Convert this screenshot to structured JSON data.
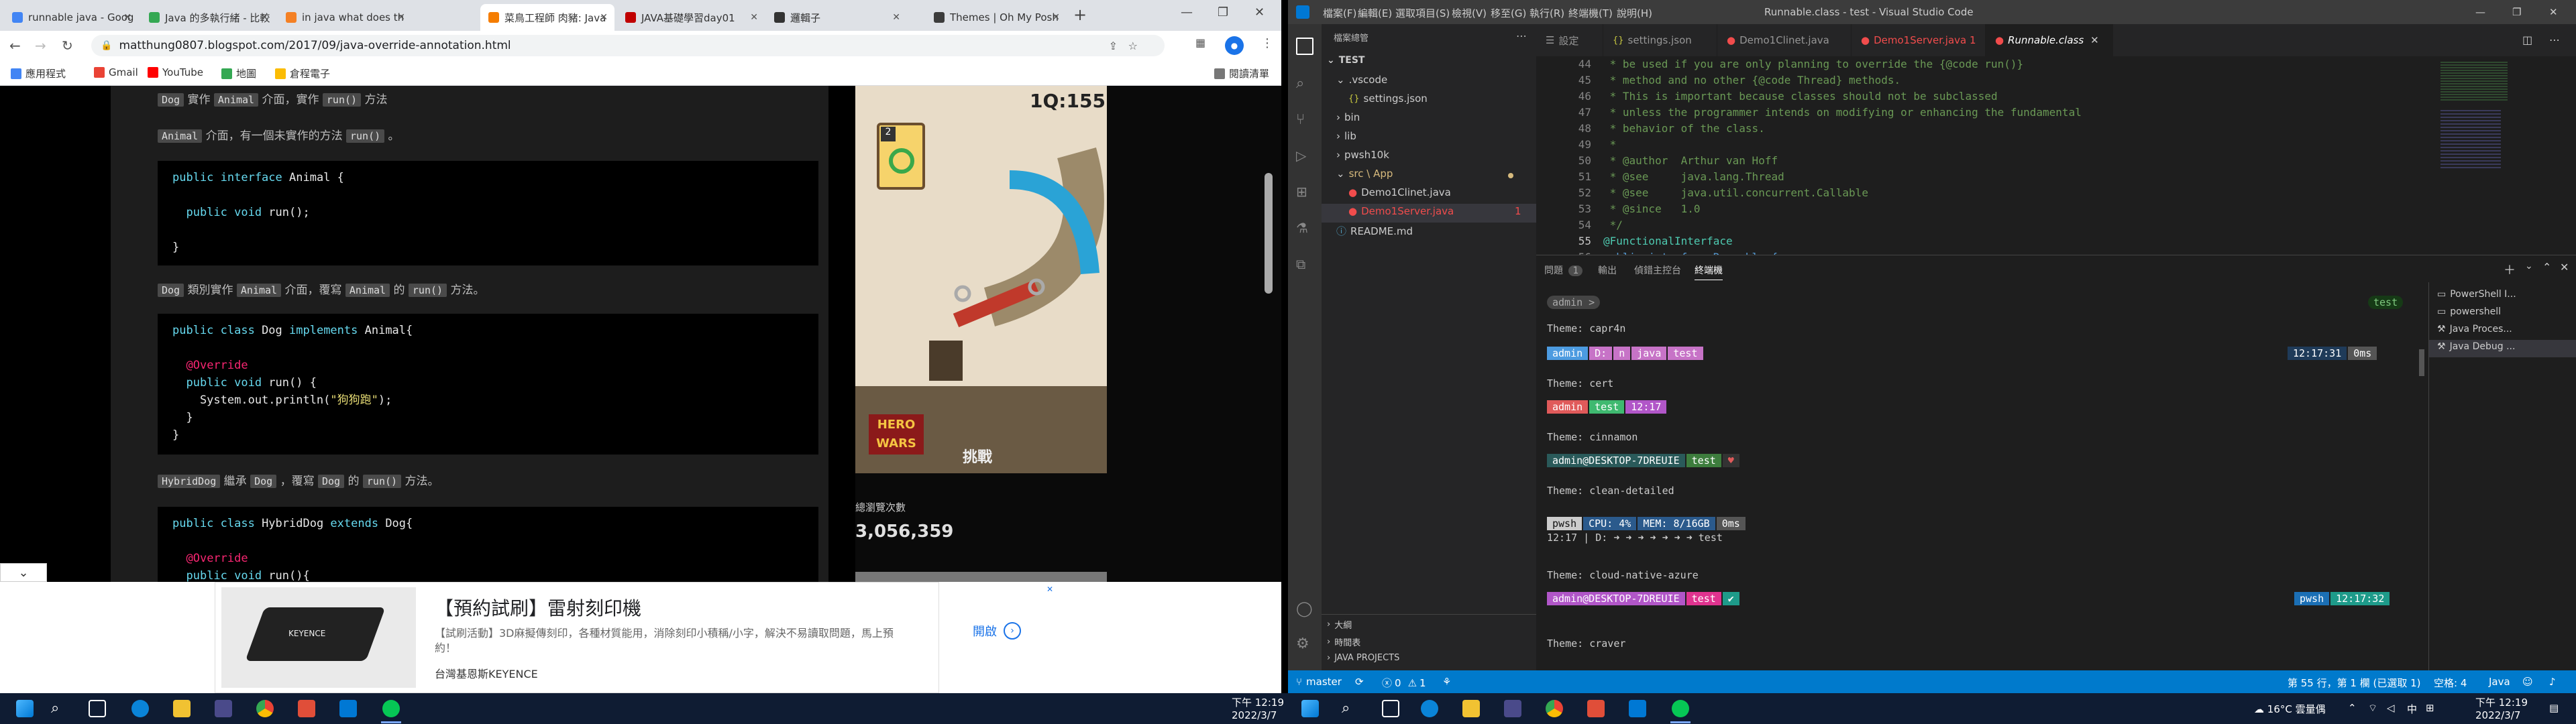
{
  "browser": {
    "tabs": [
      {
        "label": "runnable java - Goog",
        "color": "#4285f4"
      },
      {
        "label": "Java 的多執行緒 - 比較",
        "color": "#34a853"
      },
      {
        "label": "in java what does th",
        "color": "#f48024"
      },
      {
        "label": "菜鳥工程師 肉豬: Java",
        "color": "#f57d00"
      },
      {
        "label": "JAVA基礎學習day01",
        "color": "#c00000"
      },
      {
        "label": "邏輯子",
        "color": "#333333"
      },
      {
        "label": "Themes | Oh My Posh",
        "color": "#3c3c3c"
      }
    ],
    "new_tab": "+",
    "url": "matthung0807.blogspot.com/2017/09/java-override-annotation.html",
    "bookmarks": [
      "應用程式",
      "Gmail",
      "YouTube",
      "地圖",
      "倉程電子",
      "閱讀清單"
    ],
    "blog": {
      "line1": {
        "a": "Dog",
        "b": " 實作 ",
        "c": "Animal",
        "d": " 介面，實作 ",
        "e": "run()",
        "f": " 方法"
      },
      "line2": {
        "a": "Animal",
        "b": " 介面，有一個未實作的方法 ",
        "c": "run()",
        "d": " 。"
      },
      "code1": [
        "public interface Animal {",
        "",
        "  public void run();",
        "",
        "}"
      ],
      "line3": {
        "a": "Dog",
        "b": " 類別實作 ",
        "c": "Animal",
        "d": " 介面，覆寫 ",
        "e": "Animal",
        "f": " 的 ",
        "g": "run()",
        "h": " 方法。"
      },
      "code2": [
        "public class Dog implements Animal{",
        "",
        "  @Override",
        "  public void run() {",
        "    System.out.println(\"狗狗跑\");",
        "  }",
        "}"
      ],
      "line4": {
        "a": "HybridDog",
        "b": " 繼承 ",
        "c": "Dog",
        "d": " ，覆寫 ",
        "e": "Dog",
        "f": " 的 ",
        "g": "run()",
        "h": " 方法。"
      },
      "code3": [
        "public class HybridDog extends Dog{",
        "",
        "  @Override",
        "  public void run(){"
      ]
    },
    "sidebar": {
      "game_timer": "1Q:155",
      "game_badge": "2",
      "game_logo": "HERO WARS",
      "game_button": "挑戰",
      "stats_label": "總瀏覽次數",
      "stats_value": "3,056,359"
    },
    "ad": {
      "title": "【預約試刷】雷射刻印機",
      "desc": "【試刷活動】3D麻擬傳刻印，各種材質能用，消除刻印小積稱/小字，解決不易讀取問題，馬上預約！",
      "brand": "台灣基恩斯KEYENCE",
      "cta": "開啟",
      "product": "KEYENCE"
    }
  },
  "vscode": {
    "title": "Runnable.class - test - Visual Studio Code",
    "menu": [
      "檔案(F)",
      "編輯(E)",
      "選取項目(S)",
      "檢視(V)",
      "移至(G)",
      "執行(R)",
      "終端機(T)",
      "說明(H)"
    ],
    "explorer": {
      "header": "檔案總管",
      "root": "TEST",
      "items": [
        {
          "label": ".vscode",
          "type": "folder-open"
        },
        {
          "label": "settings.json",
          "type": "json"
        },
        {
          "label": "bin",
          "type": "folder"
        },
        {
          "label": "lib",
          "type": "folder"
        },
        {
          "label": "pwsh10k",
          "type": "folder"
        },
        {
          "label": "src \\ App",
          "type": "folder-open"
        },
        {
          "label": "Demo1Clinet.java",
          "type": "java-error"
        },
        {
          "label": "Demo1Server.java",
          "type": "java-error"
        },
        {
          "label": "README.md",
          "type": "md"
        }
      ],
      "error_count": "1",
      "outline": "大綱",
      "timeline": "時間表",
      "java_projects": "JAVA PROJECTS"
    },
    "tabs": [
      {
        "label": "設定",
        "color": "#cccccc"
      },
      {
        "label": "settings.json",
        "color": "#cbcb41"
      },
      {
        "label": "Demo1Clinet.java",
        "color": "#f14c4c"
      },
      {
        "label": "Demo1Server.java 1",
        "color": "#f14c4c"
      },
      {
        "label": "Runnable.class",
        "color": "#f14c4c"
      }
    ],
    "code_lines": [
      {
        "n": "44",
        "t": " * be used if you are only planning to override the {@code run()}"
      },
      {
        "n": "45",
        "t": " * method and no other {@code Thread} methods."
      },
      {
        "n": "46",
        "t": " * This is important because classes should not be subclassed"
      },
      {
        "n": "47",
        "t": " * unless the programmer intends on modifying or enhancing the fundamental"
      },
      {
        "n": "48",
        "t": " * behavior of the class."
      },
      {
        "n": "49",
        "t": " *"
      },
      {
        "n": "50",
        "t": " * @author  Arthur van Hoff"
      },
      {
        "n": "51",
        "t": " * @see     java.lang.Thread"
      },
      {
        "n": "52",
        "t": " * @see     java.util.concurrent.Callable"
      },
      {
        "n": "53",
        "t": " * @since   1.0"
      },
      {
        "n": "54",
        "t": " */"
      },
      {
        "n": "55",
        "t": "@FunctionalInterface"
      },
      {
        "n": "56",
        "t": "public interface Runnable {"
      }
    ],
    "panel_tabs": [
      "問題",
      "輸出",
      "偵錯主控台",
      "終端機"
    ],
    "panel_problem_count": "1",
    "terminal": {
      "prompt1": "admin >",
      "right1": "test",
      "themes": [
        "Theme: capr4n",
        "Theme: cert",
        "Theme: cinnamon",
        "Theme: clean-detailed",
        "Theme: cloud-native-azure",
        "Theme: craver"
      ],
      "capr4n_segs": [
        "admin",
        "D:",
        "n",
        "java",
        "test"
      ],
      "capr4n_time": "12:17:31",
      "capr4n_ms": "0ms",
      "cert_segs": [
        "admin",
        "test",
        "12:17"
      ],
      "cinnamon_segs": [
        "admin@DESKTOP-7DREUIE",
        "test",
        "♥"
      ],
      "clean_segs": [
        "pwsh",
        "CPU: 4%",
        "MEM: 8/16GB",
        "0ms"
      ],
      "clean_line2": "12:17 | D: ➜ ➜ ➜ ➜ ➜ ➜ ➜ test",
      "azure_segs": [
        "admin@DESKTOP-7DREUIE",
        "test",
        "✔"
      ],
      "azure_right": "pwsh",
      "azure_time": "12:17:32"
    },
    "terminal_list": [
      "PowerShell I...",
      "powershell",
      "Java Proces...",
      "Java Debug ..."
    ],
    "status": {
      "branch": "master",
      "errors": "0",
      "warnings": "1",
      "position": "第 55 行，第 1 欄 (已選取 1)",
      "spaces": "空格: 4",
      "lang": "Java"
    }
  },
  "taskbar_left": {
    "time": "下午 12:19",
    "date": "2022/3/7"
  },
  "taskbar_right": {
    "weather": "16°C 雲量偶",
    "lang": "中",
    "time": "下午 12:19",
    "date": "2022/3/7"
  }
}
